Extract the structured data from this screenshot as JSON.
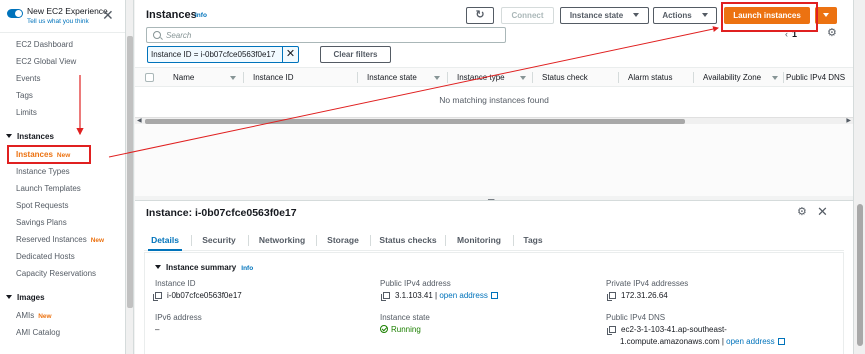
{
  "sidebar": {
    "toggle_label": "New EC2 Experience",
    "tell_us": "Tell us what you think",
    "top_links": [
      "EC2 Dashboard",
      "EC2 Global View",
      "Events",
      "Tags",
      "Limits"
    ],
    "instances_section": "Instances",
    "instances_items": [
      {
        "label": "Instances",
        "badge": "New",
        "active": true
      },
      {
        "label": "Instance Types",
        "badge": ""
      },
      {
        "label": "Launch Templates",
        "badge": ""
      },
      {
        "label": "Spot Requests",
        "badge": ""
      },
      {
        "label": "Savings Plans",
        "badge": ""
      },
      {
        "label": "Reserved Instances",
        "badge": "New"
      },
      {
        "label": "Dedicated Hosts",
        "badge": ""
      },
      {
        "label": "Capacity Reservations",
        "badge": ""
      }
    ],
    "images_section": "Images",
    "images_items": [
      {
        "label": "AMIs",
        "badge": "New"
      },
      {
        "label": "AMI Catalog",
        "badge": ""
      }
    ]
  },
  "toolbar": {
    "title": "Instances",
    "info": "Info",
    "refresh_icon": "refresh-icon",
    "connect": "Connect",
    "instance_state": "Instance state",
    "actions": "Actions",
    "launch": "Launch instances"
  },
  "search": {
    "placeholder": "Search",
    "filter_token": "Instance ID = i-0b07cfce0563f0e17",
    "clear_filters": "Clear filters"
  },
  "pagination": {
    "page": "1"
  },
  "table": {
    "columns": [
      "Name",
      "Instance ID",
      "Instance state",
      "Instance type",
      "Status check",
      "Alarm status",
      "Availability Zone",
      "Public IPv4 DNS"
    ],
    "empty_message": "No matching instances found"
  },
  "details": {
    "title": "Instance: i-0b07cfce0563f0e17",
    "tabs": [
      "Details",
      "Security",
      "Networking",
      "Storage",
      "Status checks",
      "Monitoring",
      "Tags"
    ],
    "active_tab": "Details",
    "summary_title": "Instance summary",
    "summary_info": "Info",
    "fields": {
      "instance_id_label": "Instance ID",
      "instance_id": "i-0b07cfce0563f0e17",
      "ipv6_label": "IPv6 address",
      "ipv6": "–",
      "public_ip_label": "Public IPv4 address",
      "public_ip": "3.1.103.41",
      "open_address": "open address",
      "state_label": "Instance state",
      "state": "Running",
      "private_ip_label": "Private IPv4 addresses",
      "private_ip": "172.31.26.64",
      "public_dns_label": "Public IPv4 DNS",
      "public_dns_line1": "ec2-3-1-103-41.ap-southeast-",
      "public_dns_line2": "1.compute.amazonaws.com",
      "separator": "|",
      "dns_open_address": "open address"
    }
  },
  "colors": {
    "accent_orange": "#ec7211",
    "link_blue": "#0073bb",
    "running_green": "#1d8102",
    "annotation_red": "#e02020"
  }
}
